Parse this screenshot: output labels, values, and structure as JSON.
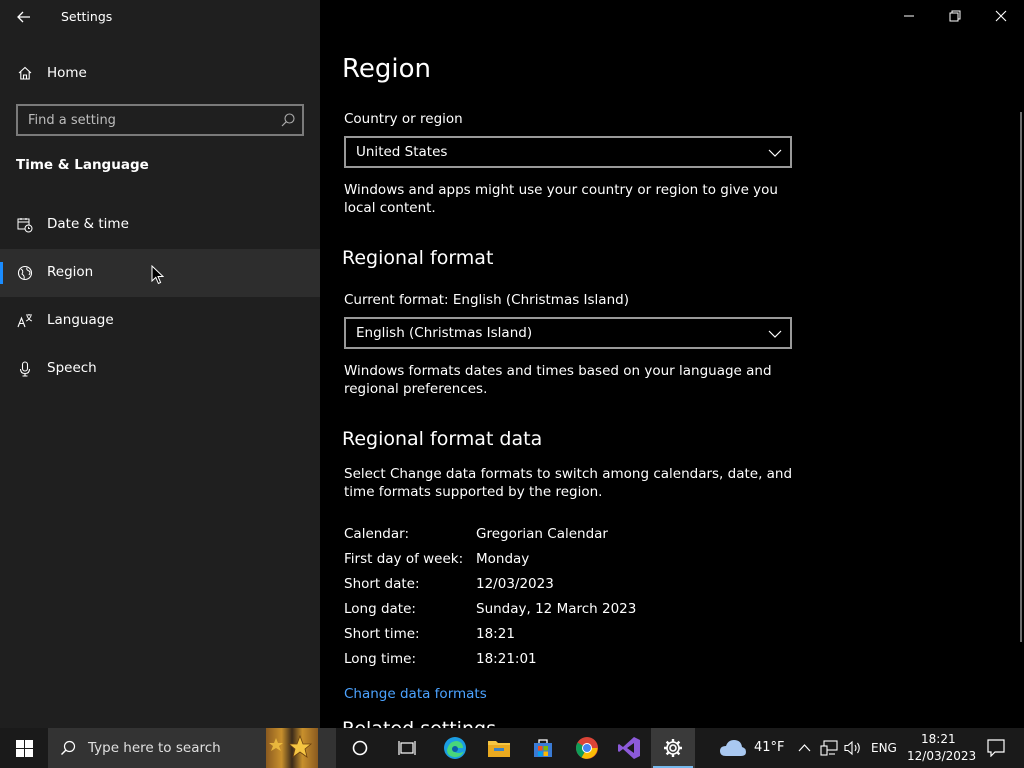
{
  "window": {
    "title": "Settings"
  },
  "sidebar": {
    "home_label": "Home",
    "search_placeholder": "Find a setting",
    "section": "Time & Language",
    "items": [
      {
        "label": "Date & time",
        "icon": "calendar-clock-icon"
      },
      {
        "label": "Region",
        "icon": "globe-icon",
        "active": true
      },
      {
        "label": "Language",
        "icon": "language-icon"
      },
      {
        "label": "Speech",
        "icon": "microphone-icon"
      }
    ]
  },
  "main": {
    "title": "Region",
    "country": {
      "label": "Country or region",
      "value": "United States",
      "description": "Windows and apps might use your country or region to give you local content."
    },
    "regional_format": {
      "heading": "Regional format",
      "label": "Current format: English (Christmas Island)",
      "value": "English (Christmas Island)",
      "description": "Windows formats dates and times based on your language and regional preferences."
    },
    "format_data": {
      "heading": "Regional format data",
      "description": "Select Change data formats to switch among calendars, date, and time formats supported by the region.",
      "rows": [
        {
          "key": "Calendar:",
          "value": "Gregorian Calendar"
        },
        {
          "key": "First day of week:",
          "value": "Monday"
        },
        {
          "key": "Short date:",
          "value": "12/03/2023"
        },
        {
          "key": "Long date:",
          "value": "Sunday, 12 March 2023"
        },
        {
          "key": "Short time:",
          "value": "18:21"
        },
        {
          "key": "Long time:",
          "value": "18:21:01"
        }
      ],
      "link": "Change data formats"
    },
    "cutoff_heading": "Related settings"
  },
  "taskbar": {
    "search_placeholder": "Type here to search",
    "weather_temp": "41°F",
    "language": "ENG",
    "time": "18:21",
    "date": "12/03/2023"
  },
  "colors": {
    "accent": "#1a8cff",
    "link": "#4ca3ff",
    "sidebar_bg": "#1f1f1f"
  }
}
